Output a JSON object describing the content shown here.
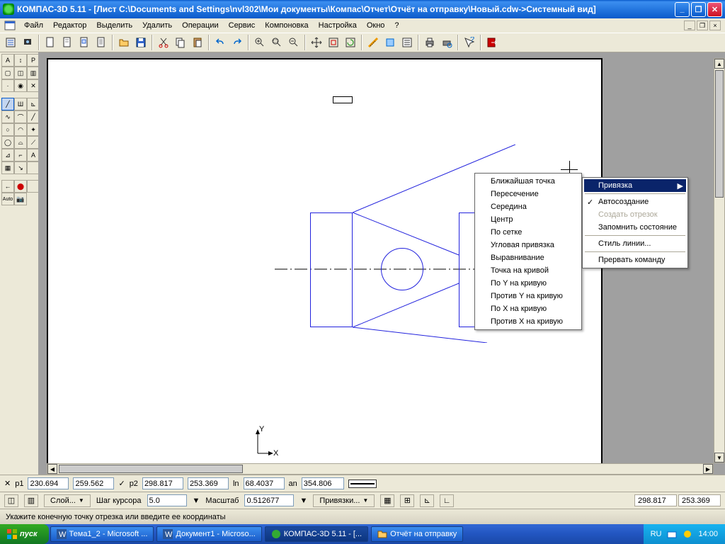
{
  "title": "КОМПАС-3D 5.11 - [Лист C:\\Documents and Settings\\nvl302\\Мои документы\\Компас\\Отчет\\Отчёт на отправку\\Новый.cdw->Системный вид]",
  "menu": {
    "items": [
      "Файл",
      "Редактор",
      "Выделить",
      "Удалить",
      "Операции",
      "Сервис",
      "Компоновка",
      "Настройка",
      "Окно",
      "?"
    ]
  },
  "context_menu_snap": {
    "items": [
      "Ближайшая точка",
      "Пересечение",
      "Середина",
      "Центр",
      "По сетке",
      "Угловая привязка",
      "Выравнивание",
      "Точка на кривой",
      "По    Y на кривую",
      "Против Y на кривую",
      "По    X на кривую",
      "Против X на кривую"
    ]
  },
  "context_menu_main": {
    "binding": "Привязка",
    "auto": "Автосоздание",
    "create_seg": "Создать отрезок",
    "remember": "Запомнить состояние",
    "style": "Стиль линии...",
    "abort": "Прервать команду"
  },
  "coordbar": {
    "p1_label": "p1",
    "p1x": "230.694",
    "p1y": "259.562",
    "p2_label": "p2",
    "p2x": "298.817",
    "p2y": "253.369",
    "ln_label": "ln",
    "ln": "68.4037",
    "an_label": "an",
    "an": "354.806"
  },
  "settingsbar": {
    "layer_btn": "Слой...",
    "step_label": "Шаг курсора",
    "step": "5.0",
    "scale_label": "Масштаб",
    "scale": "0.512677",
    "snap_btn": "Привязки...",
    "cx": "298.817",
    "cy": "253.369"
  },
  "hint": "Укажите конечную точку отрезка или введите ее координаты",
  "taskbar": {
    "start": "пуск",
    "tasks": [
      "Тема1_2 - Microsoft ...",
      "Документ1 - Microso...",
      "КОМПАС-3D 5.11 - [...",
      "Отчёт на отправку"
    ],
    "lang": "RU",
    "time": "14:00"
  },
  "axis": {
    "x": "X",
    "y": "Y"
  }
}
